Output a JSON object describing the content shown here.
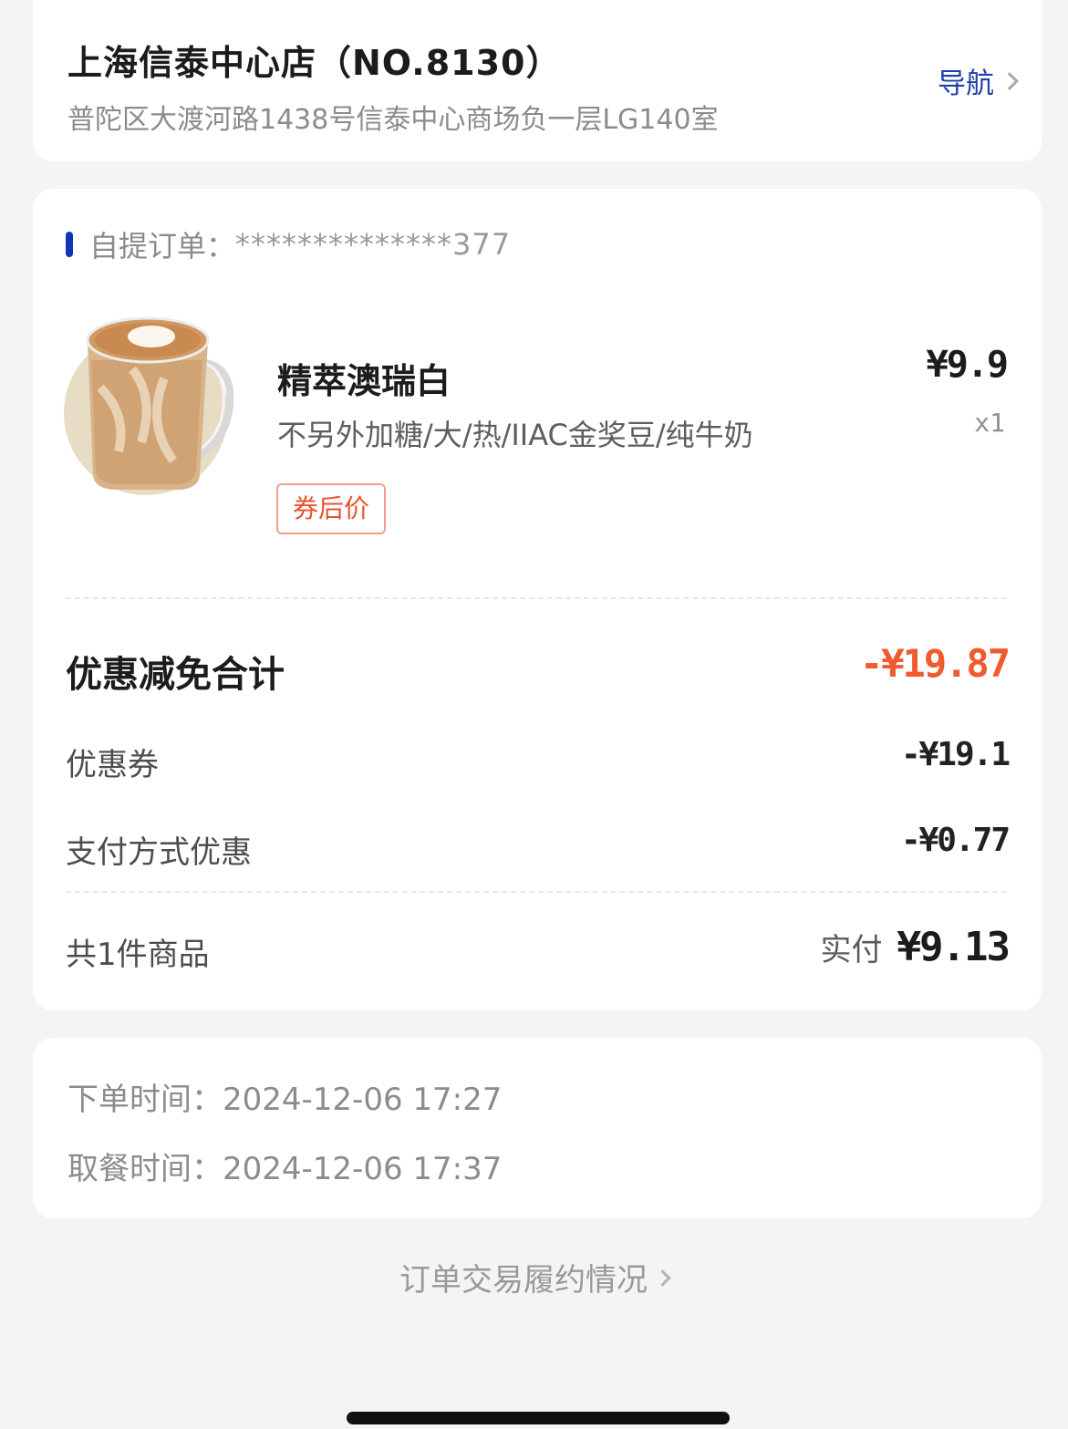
{
  "store": {
    "name": "上海信泰中心店（NO.8130）",
    "address": "普陀区大渡河路1438号信泰中心商场负一层LG140室",
    "nav_label": "导航"
  },
  "order": {
    "label": "自提订单：",
    "number_masked": "**************377",
    "accent_color": "#1035b8"
  },
  "product": {
    "name": "精萃澳瑞白",
    "spec": "不另外加糖/大/热/IIAC金奖豆/纯牛奶",
    "coupon_tag": "券后价",
    "price": "¥9.9",
    "qty": "x1",
    "image_icon": "latte-glass-cup-image"
  },
  "discount": {
    "total_label": "优惠减免合计",
    "total_value": "-¥19.87",
    "total_color": "#f05a2e",
    "items": [
      {
        "label": "优惠券",
        "value": "-¥19.1"
      },
      {
        "label": "支付方式优惠",
        "value": "-¥0.77"
      }
    ]
  },
  "summary": {
    "count_label": "共1件商品",
    "paid_label": "实付",
    "paid_value": "¥9.13"
  },
  "times": {
    "order_time_label": "下单时间：",
    "order_time": "2024-12-06 17:27",
    "pickup_time_label": "取餐时间：",
    "pickup_time": "2024-12-06 17:37"
  },
  "footer": {
    "link_label": "订单交易履约情况"
  }
}
